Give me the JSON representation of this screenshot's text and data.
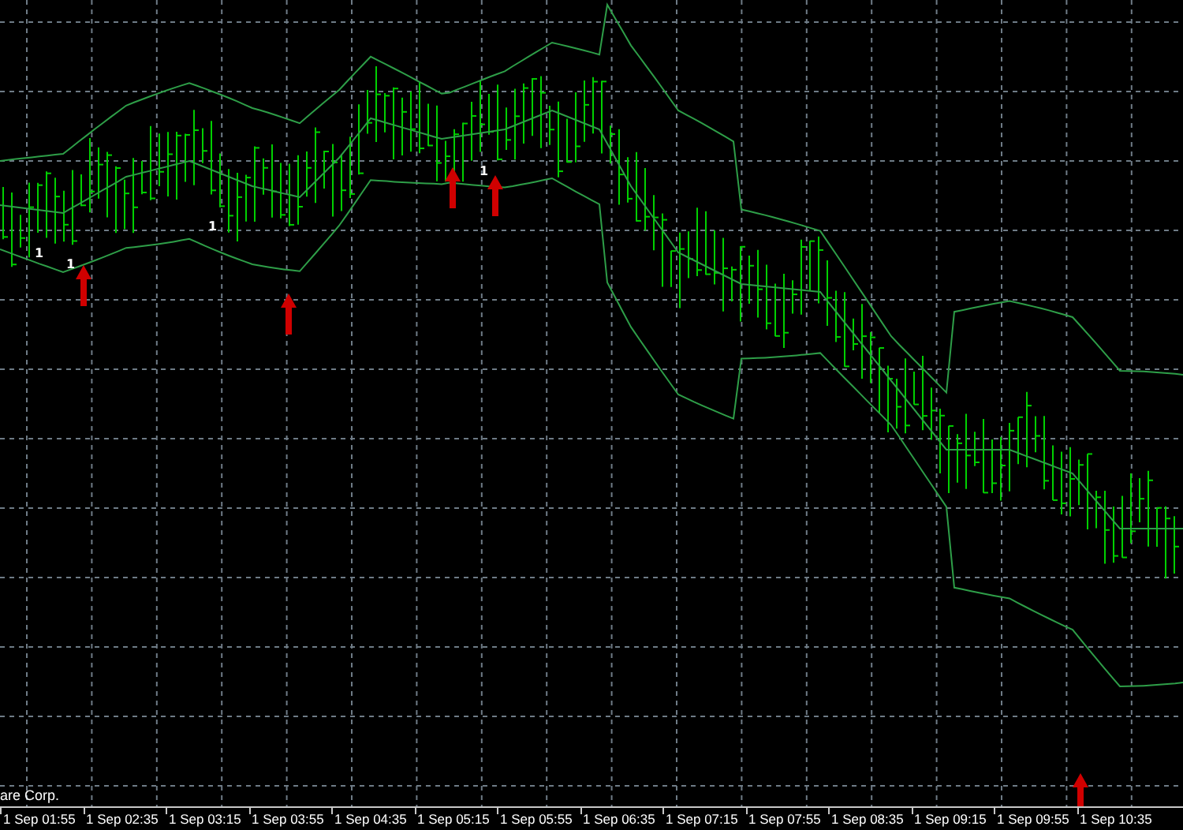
{
  "chart": {
    "copyright": "are Corp.",
    "signal_marks": [
      "1",
      "1",
      "1",
      "1"
    ]
  },
  "time_axis": {
    "labels": [
      "1 Sep 01:55",
      "1 Sep 02:35",
      "1 Sep 03:15",
      "1 Sep 03:55",
      "1 Sep 04:35",
      "1 Sep 05:15",
      "1 Sep 05:55",
      "1 Sep 06:35",
      "1 Sep 07:15",
      "1 Sep 07:55",
      "1 Sep 08:35",
      "1 Sep 09:15",
      "1 Sep 09:55",
      "1 Sep 10:35"
    ]
  }
}
